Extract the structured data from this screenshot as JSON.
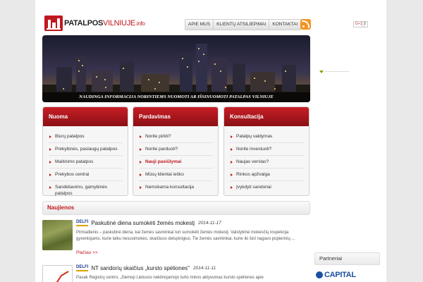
{
  "logo": {
    "part1": "PATALPOS",
    "part2": "VILNIUJE",
    "domain": ".info"
  },
  "topnav": [
    "APIE MUS",
    "KLIENTŲ ATSILIEPIMAI",
    "KONTAKTAI"
  ],
  "social": {
    "gplus_label": "G+1",
    "gplus_count": "3"
  },
  "banner": {
    "caption": "NAUDINGA INFORMACIJA NORINTIEMS NUOMOTI AR IŠSINUOMOTI PATALPAS VILNIUJE"
  },
  "boxes": [
    {
      "title": "Nuoma",
      "items": [
        "Biurų patalpos",
        "Prekybinės, paslaugų patalpos",
        "Maitinimo patalpos",
        "Prekybos centrai",
        "Sandėliavimo, gamybinės patalpos"
      ]
    },
    {
      "title": "Pardavimas",
      "items": [
        "Norite pirkti?",
        "Norite parduoti?",
        "Nauji pasiūlymai",
        "Mūsų klientai ieško",
        "Nemokama konsultacija"
      ],
      "highlight": 2
    },
    {
      "title": "Konsultacija",
      "items": [
        "Patalpų valdymas",
        "Norite investuoti?",
        "Naujas verslas?",
        "Rinkos apžvalga",
        "Įvykdyti sandoriai"
      ]
    }
  ],
  "news": {
    "heading": "Naujienos",
    "items": [
      {
        "source": "DELFI",
        "title": "Paskutinė diena sumokėti žemės mokestį",
        "date": "2014-11-17",
        "text": "Pirmadienis – paskutinė diena, kai žemės savininkai turi sumokėti žemės mokestį. Valstybinė mokesčių inspekcija gyventojams, kurie laiku nesusimokės, skaičiuos delspinigius. Tie žemės savininkai, kurie iki šiol nagavo popierinių ...",
        "more": "Plačiau >>"
      },
      {
        "source": "DELFI",
        "title": "NT sandorių skaičius „kursto spėliones\"",
        "date": "2014-11-11",
        "text": "Pasak Registrų centro, „žiemop Lietuvos nekilnojamojo turto rinkos aktyvumas kursto spėliones apie"
      }
    ]
  },
  "sidebar": {
    "partners_title": "Partneriai",
    "partner_logo": "CAPITAL"
  }
}
